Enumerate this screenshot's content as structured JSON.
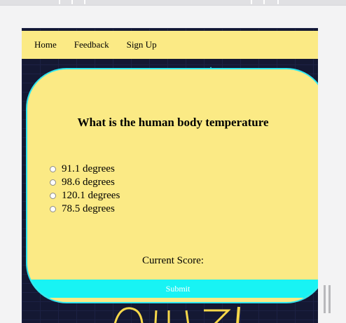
{
  "nav": {
    "items": [
      {
        "label": "Home"
      },
      {
        "label": "Feedback"
      },
      {
        "label": "Sign Up"
      }
    ]
  },
  "quiz": {
    "question": "What is the human body temperature",
    "options": [
      {
        "label": "91.1 degrees"
      },
      {
        "label": "98.6 degrees"
      },
      {
        "label": "120.1 degrees"
      },
      {
        "label": "78.5 degrees"
      }
    ],
    "score_label": "Current Score:",
    "submit_label": "Submit"
  },
  "colors": {
    "card_bg": "#fbea85",
    "accent": "#18f3f4",
    "page_bg": "#141833"
  }
}
